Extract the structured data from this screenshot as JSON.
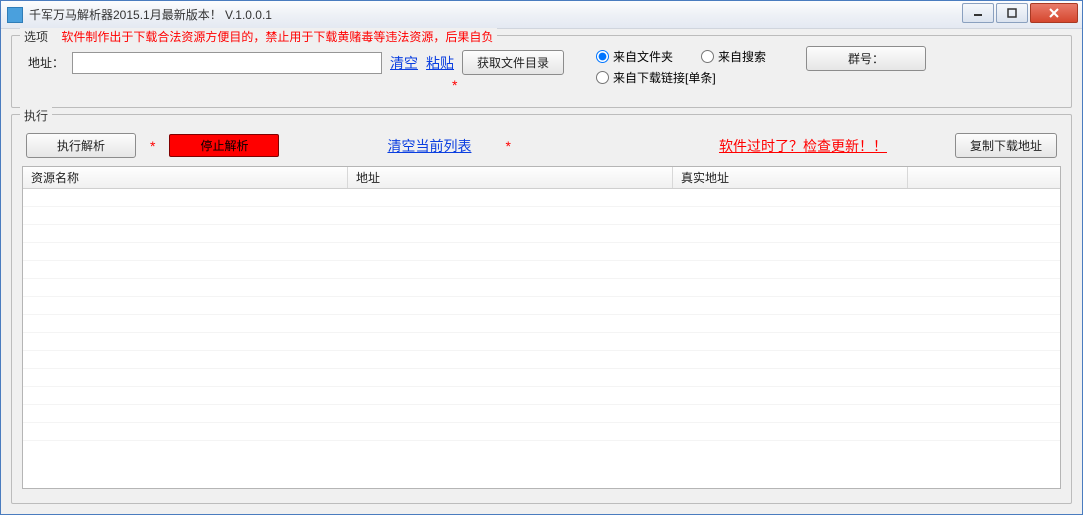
{
  "window": {
    "title": "千军万马解析器2015.1月最新版本！ V.1.0.0.1"
  },
  "options": {
    "legend": "选项",
    "warning": "软件制作出于下载合法资源方便目的，禁止用于下载黄赌毒等违法资源，后果自负",
    "addr_label": "地址：",
    "addr_value": "",
    "clear_link": "清空",
    "paste_link": "粘贴",
    "fetch_dir_btn": "获取文件目录",
    "radio_folder": "来自文件夹",
    "radio_search": "来自搜索",
    "radio_single": "来自下载链接[单条]",
    "asterisk": "*",
    "group_btn": "群号："
  },
  "exec": {
    "legend": "执行",
    "parse_btn": "执行解析",
    "stop_btn": "停止解析",
    "clear_list_link": "清空当前列表",
    "update_link": "软件过时了？检查更新！！",
    "copy_btn": "复制下载地址",
    "asterisk": "*"
  },
  "table": {
    "cols": [
      "资源名称",
      "地址",
      "真实地址",
      ""
    ]
  }
}
